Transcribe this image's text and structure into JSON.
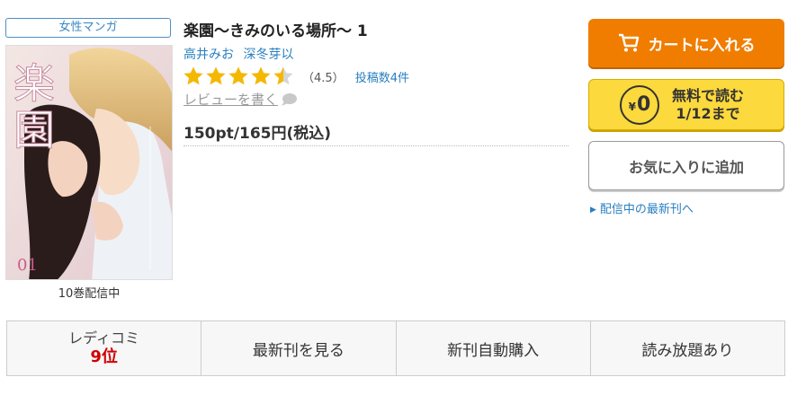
{
  "genre_badge": "女性マンガ",
  "cover": {
    "title_glyphs": "楽園",
    "volume": "01"
  },
  "cover_caption": "10巻配信中",
  "book": {
    "title": "楽園～きみのいる場所～ 1",
    "authors": [
      "高井みお",
      "深冬芽以"
    ],
    "rating": 4.5,
    "rating_text": "（4.5）",
    "review_count": "投稿数4件",
    "write_review": "レビューを書く",
    "price": "150pt/165円(税込)"
  },
  "actions": {
    "cart": "カートに入れる",
    "free_coin": "0",
    "free_line1": "無料で読む",
    "free_line2": "1/12まで",
    "favorite": "お気に入りに追加",
    "latest_link": "配信中の最新刊へ"
  },
  "bottom": {
    "ranking_label": "レディコミ",
    "ranking_value": "9位",
    "latest": "最新刊を見る",
    "auto_buy": "新刊自動購入",
    "unlimited": "読み放題あり"
  },
  "colors": {
    "cart": "#f07d00",
    "free": "#fcd93c",
    "link": "#2a7fc0",
    "rank": "#d00000",
    "star": "#f5b800"
  }
}
